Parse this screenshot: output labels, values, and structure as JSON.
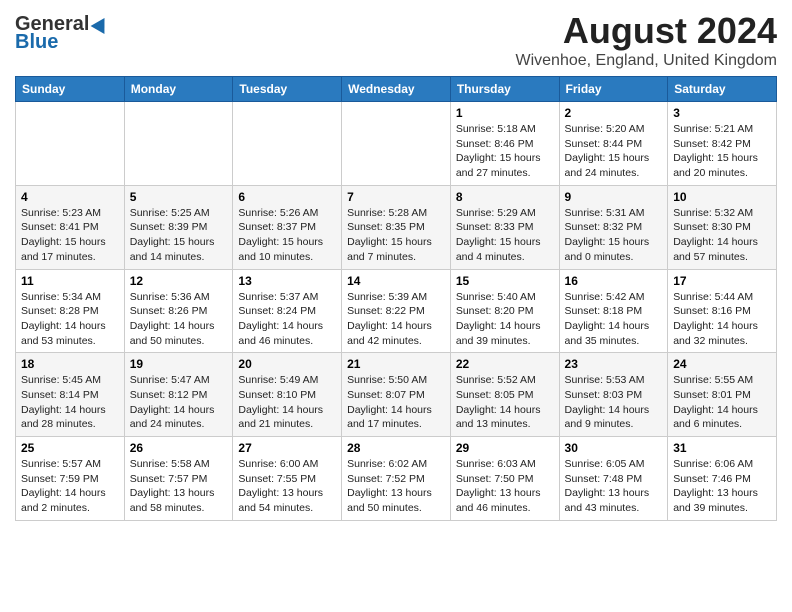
{
  "logo": {
    "general": "General",
    "blue": "Blue"
  },
  "title": "August 2024",
  "subtitle": "Wivenhoe, England, United Kingdom",
  "headers": [
    "Sunday",
    "Monday",
    "Tuesday",
    "Wednesday",
    "Thursday",
    "Friday",
    "Saturday"
  ],
  "weeks": [
    [
      {
        "day": "",
        "info": ""
      },
      {
        "day": "",
        "info": ""
      },
      {
        "day": "",
        "info": ""
      },
      {
        "day": "",
        "info": ""
      },
      {
        "day": "1",
        "info": "Sunrise: 5:18 AM\nSunset: 8:46 PM\nDaylight: 15 hours and 27 minutes."
      },
      {
        "day": "2",
        "info": "Sunrise: 5:20 AM\nSunset: 8:44 PM\nDaylight: 15 hours and 24 minutes."
      },
      {
        "day": "3",
        "info": "Sunrise: 5:21 AM\nSunset: 8:42 PM\nDaylight: 15 hours and 20 minutes."
      }
    ],
    [
      {
        "day": "4",
        "info": "Sunrise: 5:23 AM\nSunset: 8:41 PM\nDaylight: 15 hours and 17 minutes."
      },
      {
        "day": "5",
        "info": "Sunrise: 5:25 AM\nSunset: 8:39 PM\nDaylight: 15 hours and 14 minutes."
      },
      {
        "day": "6",
        "info": "Sunrise: 5:26 AM\nSunset: 8:37 PM\nDaylight: 15 hours and 10 minutes."
      },
      {
        "day": "7",
        "info": "Sunrise: 5:28 AM\nSunset: 8:35 PM\nDaylight: 15 hours and 7 minutes."
      },
      {
        "day": "8",
        "info": "Sunrise: 5:29 AM\nSunset: 8:33 PM\nDaylight: 15 hours and 4 minutes."
      },
      {
        "day": "9",
        "info": "Sunrise: 5:31 AM\nSunset: 8:32 PM\nDaylight: 15 hours and 0 minutes."
      },
      {
        "day": "10",
        "info": "Sunrise: 5:32 AM\nSunset: 8:30 PM\nDaylight: 14 hours and 57 minutes."
      }
    ],
    [
      {
        "day": "11",
        "info": "Sunrise: 5:34 AM\nSunset: 8:28 PM\nDaylight: 14 hours and 53 minutes."
      },
      {
        "day": "12",
        "info": "Sunrise: 5:36 AM\nSunset: 8:26 PM\nDaylight: 14 hours and 50 minutes."
      },
      {
        "day": "13",
        "info": "Sunrise: 5:37 AM\nSunset: 8:24 PM\nDaylight: 14 hours and 46 minutes."
      },
      {
        "day": "14",
        "info": "Sunrise: 5:39 AM\nSunset: 8:22 PM\nDaylight: 14 hours and 42 minutes."
      },
      {
        "day": "15",
        "info": "Sunrise: 5:40 AM\nSunset: 8:20 PM\nDaylight: 14 hours and 39 minutes."
      },
      {
        "day": "16",
        "info": "Sunrise: 5:42 AM\nSunset: 8:18 PM\nDaylight: 14 hours and 35 minutes."
      },
      {
        "day": "17",
        "info": "Sunrise: 5:44 AM\nSunset: 8:16 PM\nDaylight: 14 hours and 32 minutes."
      }
    ],
    [
      {
        "day": "18",
        "info": "Sunrise: 5:45 AM\nSunset: 8:14 PM\nDaylight: 14 hours and 28 minutes."
      },
      {
        "day": "19",
        "info": "Sunrise: 5:47 AM\nSunset: 8:12 PM\nDaylight: 14 hours and 24 minutes."
      },
      {
        "day": "20",
        "info": "Sunrise: 5:49 AM\nSunset: 8:10 PM\nDaylight: 14 hours and 21 minutes."
      },
      {
        "day": "21",
        "info": "Sunrise: 5:50 AM\nSunset: 8:07 PM\nDaylight: 14 hours and 17 minutes."
      },
      {
        "day": "22",
        "info": "Sunrise: 5:52 AM\nSunset: 8:05 PM\nDaylight: 14 hours and 13 minutes."
      },
      {
        "day": "23",
        "info": "Sunrise: 5:53 AM\nSunset: 8:03 PM\nDaylight: 14 hours and 9 minutes."
      },
      {
        "day": "24",
        "info": "Sunrise: 5:55 AM\nSunset: 8:01 PM\nDaylight: 14 hours and 6 minutes."
      }
    ],
    [
      {
        "day": "25",
        "info": "Sunrise: 5:57 AM\nSunset: 7:59 PM\nDaylight: 14 hours and 2 minutes."
      },
      {
        "day": "26",
        "info": "Sunrise: 5:58 AM\nSunset: 7:57 PM\nDaylight: 13 hours and 58 minutes."
      },
      {
        "day": "27",
        "info": "Sunrise: 6:00 AM\nSunset: 7:55 PM\nDaylight: 13 hours and 54 minutes."
      },
      {
        "day": "28",
        "info": "Sunrise: 6:02 AM\nSunset: 7:52 PM\nDaylight: 13 hours and 50 minutes."
      },
      {
        "day": "29",
        "info": "Sunrise: 6:03 AM\nSunset: 7:50 PM\nDaylight: 13 hours and 46 minutes."
      },
      {
        "day": "30",
        "info": "Sunrise: 6:05 AM\nSunset: 7:48 PM\nDaylight: 13 hours and 43 minutes."
      },
      {
        "day": "31",
        "info": "Sunrise: 6:06 AM\nSunset: 7:46 PM\nDaylight: 13 hours and 39 minutes."
      }
    ]
  ]
}
